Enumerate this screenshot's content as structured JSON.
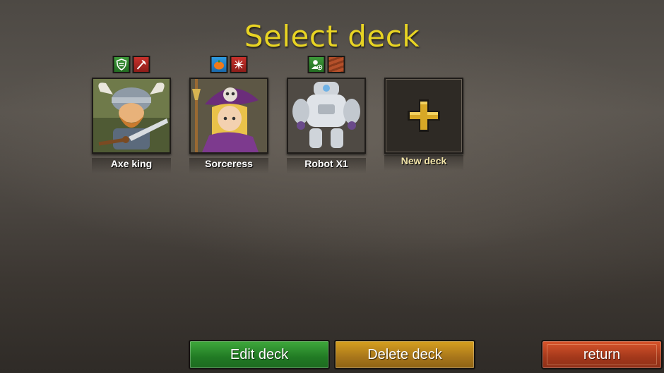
{
  "screen": {
    "title": "Select deck"
  },
  "decks": [
    {
      "name": "Axe king",
      "badges": [
        "shield-icon",
        "axe-icon"
      ]
    },
    {
      "name": "Sorceress",
      "badges": [
        "pumpkin-icon",
        "spark-icon"
      ]
    },
    {
      "name": "Robot X1",
      "badges": [
        "person-add-icon",
        "wood-icon"
      ]
    },
    {
      "name": "New deck"
    }
  ],
  "buttons": {
    "edit": "Edit deck",
    "delete": "Delete deck",
    "return": "return"
  },
  "colors": {
    "title": "#e8d423",
    "edit_button": "#2f8f2f",
    "delete_button": "#b9851c",
    "return_button": "#b5431f"
  }
}
